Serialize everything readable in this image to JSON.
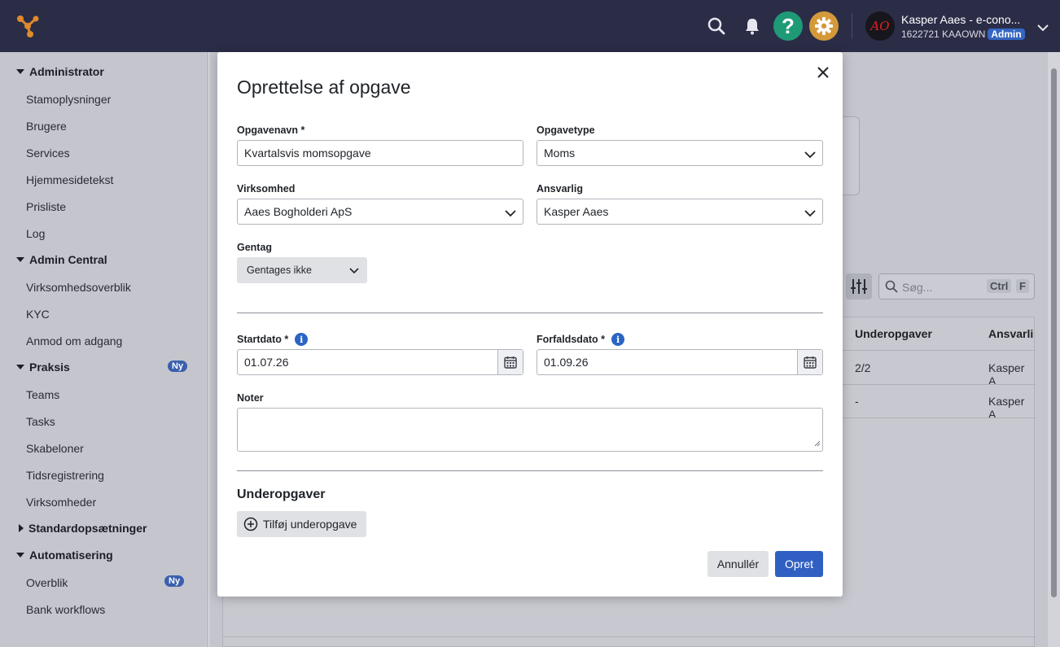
{
  "topbar": {
    "user_name": "Kasper Aaes - e-cono...",
    "user_account": "1622721 KAAOWN",
    "admin_badge": "Admin",
    "avatar_initials": "AO",
    "help_icon": "question-mark",
    "colors": {
      "bar": "#2b2d47",
      "help": "#1f9a76",
      "settings": "#d49a3a",
      "accent": "#2f5fc3"
    }
  },
  "sidebar": {
    "sections": [
      {
        "label": "Administrator",
        "expanded": true,
        "items": [
          "Stamoplysninger",
          "Brugere",
          "Services",
          "Hjemmesidetekst",
          "Prisliste",
          "Log"
        ]
      },
      {
        "label": "Admin Central",
        "expanded": true,
        "items": [
          "Virksomhedsoverblik",
          "KYC",
          "Anmod om adgang"
        ]
      },
      {
        "label": "Praksis",
        "expanded": true,
        "badge": "Ny",
        "items": [
          "Teams",
          "Tasks",
          "Skabeloner",
          "Tidsregistrering",
          "Virksomheder"
        ]
      },
      {
        "label": "Standardopsætninger",
        "expanded": false,
        "items": []
      },
      {
        "label": "Automatisering",
        "expanded": true,
        "items": [
          "Overblik",
          "Bank workflows"
        ],
        "item_badge": "Ny"
      }
    ]
  },
  "background": {
    "search_placeholder": "Søg...",
    "kbd_ctrl": "Ctrl",
    "kbd_f": "F",
    "table": {
      "headers": [
        "Underopgaver",
        "Ansvarli"
      ],
      "rows": [
        [
          "2/2",
          "Kasper A"
        ],
        [
          "-",
          "Kasper A"
        ]
      ]
    }
  },
  "modal": {
    "title": "Oprettelse af opgave",
    "fields": {
      "task_name": {
        "label": "Opgavenavn *",
        "value": "Kvartalsvis momsopgave"
      },
      "task_type": {
        "label": "Opgavetype",
        "value": "Moms"
      },
      "company": {
        "label": "Virksomhed",
        "value": "Aaes Bogholderi ApS"
      },
      "responsible": {
        "label": "Ansvarlig",
        "value": "Kasper Aaes"
      },
      "repeat": {
        "label": "Gentag",
        "value": "Gentages ikke"
      },
      "start_date": {
        "label": "Startdato *",
        "value": "01.07.26"
      },
      "due_date": {
        "label": "Forfaldsdato *",
        "value": "01.09.26"
      },
      "notes": {
        "label": "Noter",
        "value": ""
      }
    },
    "subtasks_heading": "Underopgaver",
    "add_subtask_label": "Tilføj underopgave",
    "cancel_label": "Annullér",
    "create_label": "Opret"
  }
}
